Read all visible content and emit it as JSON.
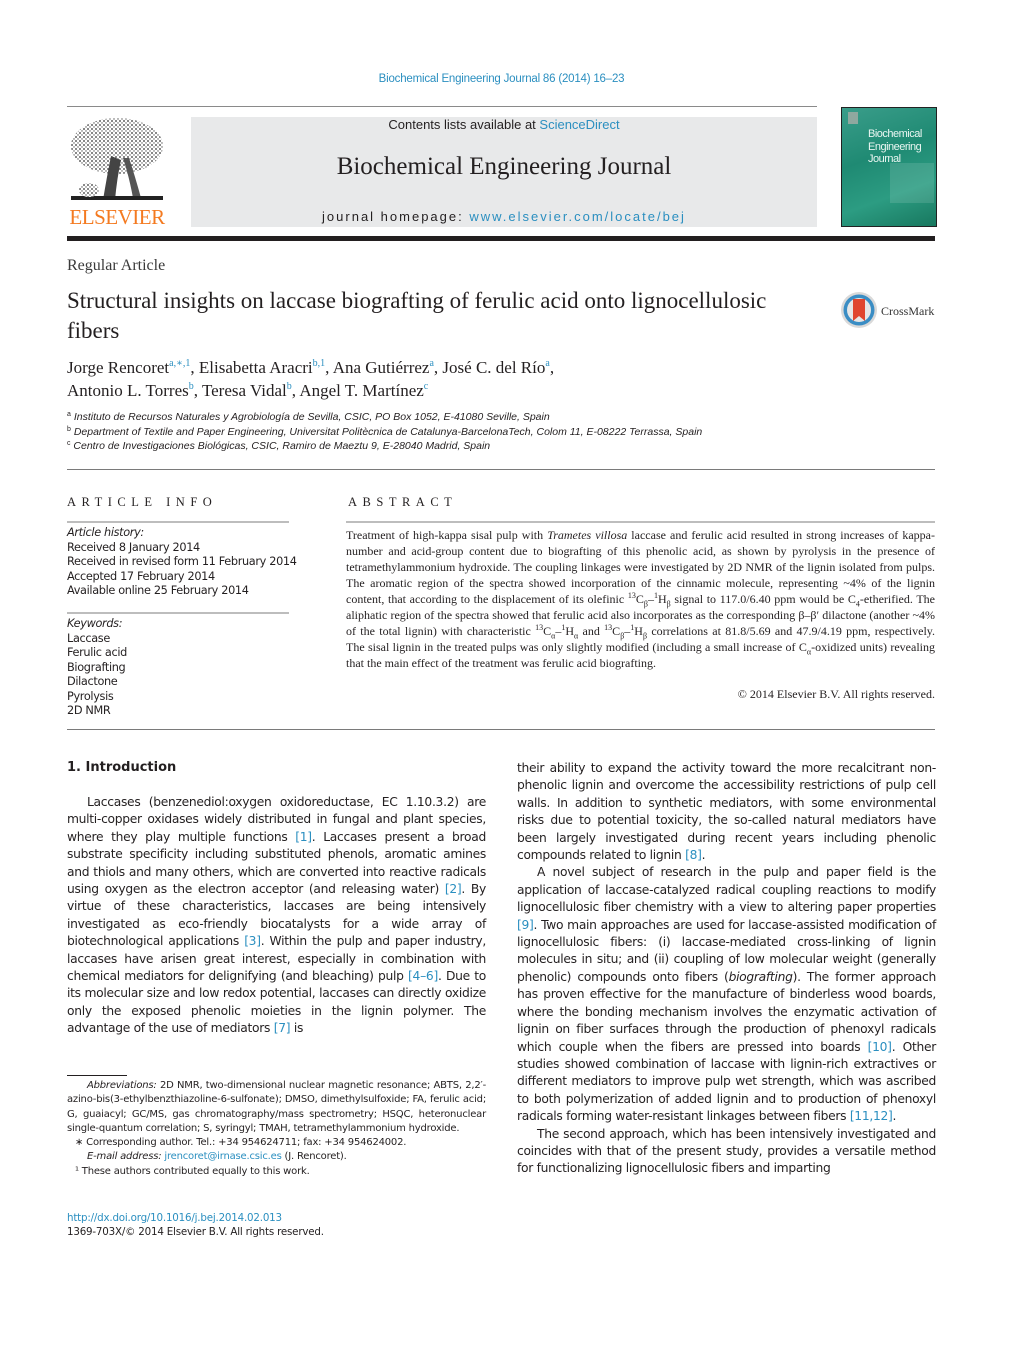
{
  "header": {
    "journal_reference": "Biochemical Engineering Journal 86 (2014) 16–23",
    "contents_prefix": "Contents lists available at ",
    "contents_link": "ScienceDirect",
    "journal_name": "Biochemical Engineering Journal",
    "homepage_prefix": "journal homepage: ",
    "homepage_link": "www.elsevier.com/locate/bej",
    "publisher_logo_text": "ELSEVIER",
    "cover_title_lines": [
      "Biochemical",
      "Engineering",
      "Journal"
    ],
    "crossmark_label": "CrossMark"
  },
  "colors": {
    "link": "#2b8fc0",
    "elsevier_orange": "#f47a20",
    "cover_green": "#1f8a73",
    "masthead_gray": "#e8e9ea"
  },
  "article": {
    "type": "Regular Article",
    "title": "Structural insights on laccase biografting of ferulic acid onto lignocellulosic fibers",
    "authors": [
      {
        "name": "Jorge Rencoret",
        "marks": "a,∗,1",
        "sep": ", "
      },
      {
        "name": "Elisabetta Aracri",
        "marks": "b,1",
        "sep": ", "
      },
      {
        "name": "Ana Gutiérrez",
        "marks": "a",
        "sep": ", "
      },
      {
        "name": "José C. del Río",
        "marks": "a",
        "sep": ","
      },
      {
        "name": "Antonio L. Torres",
        "marks": "b",
        "sep": ", "
      },
      {
        "name": "Teresa Vidal",
        "marks": "b",
        "sep": ", "
      },
      {
        "name": "Angel T. Martínez",
        "marks": "c",
        "sep": ""
      }
    ],
    "affiliations": [
      {
        "mark": "a",
        "text": "Instituto de Recursos Naturales y Agrobiología de Sevilla, CSIC, PO Box 1052, E-41080 Seville, Spain"
      },
      {
        "mark": "b",
        "text": "Department of Textile and Paper Engineering, Universitat Politècnica de Catalunya-BarcelonaTech, Colom 11, E-08222 Terrassa, Spain"
      },
      {
        "mark": "c",
        "text": "Centro de Investigaciones Biológicas, CSIC, Ramiro de Maeztu 9, E-28040 Madrid, Spain"
      }
    ]
  },
  "article_info": {
    "heading": "ARTICLE INFO",
    "history_label": "Article history:",
    "history": [
      "Received 8 January 2014",
      "Received in revised form 11 February 2014",
      "Accepted 17 February 2014",
      "Available online 25 February 2014"
    ],
    "keywords_label": "Keywords:",
    "keywords": [
      "Laccase",
      "Ferulic acid",
      "Biografting",
      "Dilactone",
      "Pyrolysis",
      "2D NMR"
    ]
  },
  "abstract": {
    "heading": "ABSTRACT",
    "s1": "Treatment of high-kappa sisal pulp with ",
    "s1_italic": "Trametes villosa",
    "s2": " laccase and ferulic acid resulted in strong increases of kappa-number and acid-group content due to biografting of this phenolic acid, as shown by pyrolysis in the presence of tetramethylammonium hydroxide. The coupling linkages were investigated by 2D NMR of the lignin isolated from pulps. The aromatic region of the spectra showed incorporation of the cinnamic molecule, representing ~4% of the lignin content, that according to the displacement of its olefinic ",
    "s3": " signal to 117.0/6.40 ppm would be C",
    "s4": "-etherified. The aliphatic region of the spectra showed that ferulic acid also incorporates as the corresponding β–β′ dilactone (another ~4% of the total lignin) with characteristic ",
    "s5": " and ",
    "s6": " correlations at 81.8/5.69 and 47.9/4.19 ppm, respectively. The sisal lignin in the treated pulps was only slightly modified (including a small increase of C",
    "s7": "-oxidized units) revealing that the main effect of the treatment was ferulic acid biografting.",
    "copyright": "© 2014 Elsevier B.V. All rights reserved."
  },
  "introduction": {
    "heading": "1.  Introduction",
    "left_p1": [
      {
        "t": "Laccases (benzenediol:oxygen oxidoreductase, EC 1.10.3.2) are multi-copper oxidases widely distributed in fungal and plant species, where they play multiple functions "
      },
      {
        "ref": "[1]"
      },
      {
        "t": ". Laccases present a broad substrate specificity including substituted phenols, aromatic amines and thiols and many others, which are converted into reactive radicals using oxygen as the electron acceptor (and releasing water) "
      },
      {
        "ref": "[2]"
      },
      {
        "t": ". By virtue of these characteristics, laccases are being intensively investigated as eco-friendly biocatalysts for a wide array of biotechnological applications "
      },
      {
        "ref": "[3]"
      },
      {
        "t": ". Within the pulp and paper industry, laccases have arisen great interest, especially in combination with chemical mediators for delignifying (and bleaching) pulp "
      },
      {
        "ref": "[4–6]"
      },
      {
        "t": ". Due to its molecular size and low redox potential, laccases can directly oxidize only the exposed phenolic moieties in the lignin polymer. The advantage of the use of mediators "
      },
      {
        "ref": "[7]"
      },
      {
        "t": " is"
      }
    ],
    "right_p1": [
      {
        "t": "their ability to expand the activity toward the more recalcitrant non-phenolic lignin and overcome the accessibility restrictions of pulp cell walls. In addition to synthetic mediators, with some environmental risks due to potential toxicity, the so-called natural mediators have been largely investigated during recent years including phenolic compounds related to lignin "
      },
      {
        "ref": "[8]"
      },
      {
        "t": "."
      }
    ],
    "right_p2": [
      {
        "t": "A novel subject of research in the pulp and paper field is the application of laccase-catalyzed radical coupling reactions to modify lignocellulosic fiber chemistry with a view to altering paper properties "
      },
      {
        "ref": "[9]"
      },
      {
        "t": ". Two main approaches are used for laccase-assisted modification of lignocellulosic fibers: (i) laccase-mediated cross-linking of lignin molecules in situ; and (ii) coupling of low molecular weight (generally phenolic) compounds onto fibers ("
      },
      {
        "i": "biografting"
      },
      {
        "t": "). The former approach has proven effective for the manufacture of binderless wood boards, where the bonding mechanism involves the enzymatic activation of lignin on fiber surfaces through the production of phenoxyl radicals which couple when the fibers are pressed into boards "
      },
      {
        "ref": "[10]"
      },
      {
        "t": ". Other studies showed combination of laccase with lignin-rich extractives or different mediators to improve pulp wet strength, which was ascribed to both polymerization of added lignin and to production of phenoxyl radicals forming water-resistant linkages between fibers "
      },
      {
        "ref": "[11,12]"
      },
      {
        "t": "."
      }
    ],
    "right_p3": [
      {
        "t": "The second approach, which has been intensively investigated and coincides with that of the present study, provides a versatile method for functionalizing lignocellulosic fibers and imparting"
      }
    ]
  },
  "footnotes": {
    "abbreviations_label": "Abbreviations:",
    "abbreviations_text": "  2D NMR, two-dimensional nuclear magnetic resonance; ABTS, 2,2′-azino-bis(3-ethylbenzthiazoline-6-sulfonate); DMSO, dimethylsulfoxide; FA, ferulic acid; G, guaiacyl; GC/MS, gas chromatography/mass spectrometry; HSQC, heteronuclear single-quantum correlation; S, syringyl; TMAH, tetramethylammonium hydroxide.",
    "corresponding": "∗  Corresponding author. Tel.: +34 954624711; fax: +34 954624002.",
    "email_label": "E-mail address: ",
    "email": "jrencoret@irnase.csic.es",
    "email_suffix": " (J. Rencoret).",
    "equal_contrib": "¹  These authors contributed equally to this work."
  },
  "footer": {
    "doi": "http://dx.doi.org/10.1016/j.bej.2014.02.013",
    "issn_copyright": "1369-703X/© 2014 Elsevier B.V. All rights reserved."
  }
}
